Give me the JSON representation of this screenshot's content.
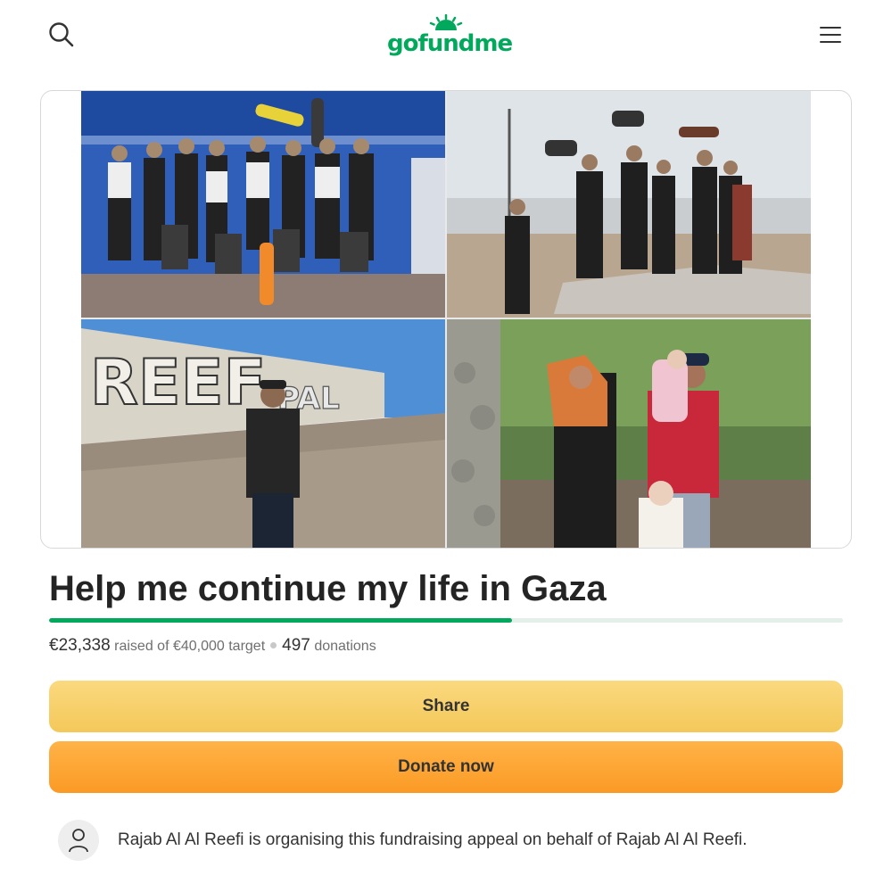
{
  "header": {
    "logo_text": "gofundme",
    "brand_color": "#02a95c",
    "search_icon": "search-icon",
    "menu_icon": "menu-icon"
  },
  "hero": {
    "tiles": [
      {
        "icon": "photo-group-skaters-stage"
      },
      {
        "icon": "photo-skaters-on-ramp"
      },
      {
        "icon": "photo-man-graffiti-wall"
      },
      {
        "icon": "photo-family-garden"
      }
    ]
  },
  "campaign": {
    "title": "Help me continue my life in Gaza",
    "progress_fraction": 0.583,
    "raised": "€23,338",
    "raised_label": "raised of €40,000 target",
    "donations_count": "497",
    "donations_label": "donations"
  },
  "actions": {
    "share_label": "Share",
    "donate_label": "Donate now"
  },
  "organiser": {
    "text": "Rajab Al Al Reefi is organising this fundraising appeal on behalf of Rajab Al Al Reefi.",
    "avatar_icon": "user-icon"
  }
}
